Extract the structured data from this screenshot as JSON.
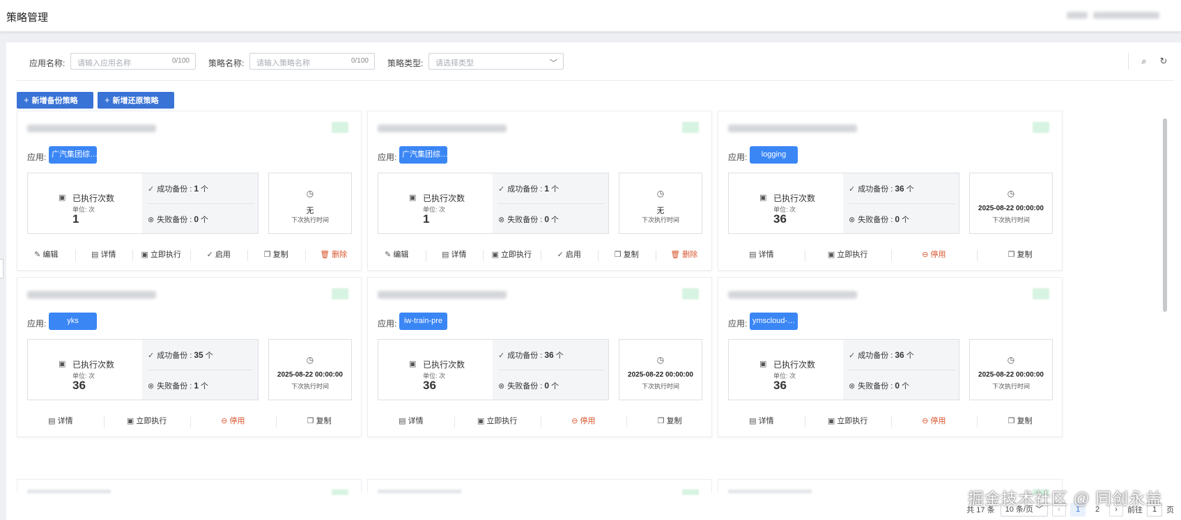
{
  "header": {
    "title": "策略管理"
  },
  "filters": {
    "app_name": {
      "label": "应用名称:",
      "placeholder": "请输入应用名称",
      "counter": "0/100"
    },
    "policy_name": {
      "label": "策略名称:",
      "placeholder": "请输入策略名称",
      "counter": "0/100"
    },
    "policy_type": {
      "label": "策略类型:",
      "placeholder": "请选择类型"
    }
  },
  "toolbar": {
    "add_backup_label": "新增备份策略",
    "add_restore_label": "新增还原策略",
    "plus_icon": "+"
  },
  "labels": {
    "app_prefix": "应用:",
    "exec_title": "已执行次数",
    "exec_unit": "单位: 次",
    "success_label": "成功备份 :",
    "fail_label": "失败备份 :",
    "count_unit": "个",
    "next_caption": "下次执行时间"
  },
  "cards": [
    {
      "app": "广汽集团综…",
      "exec_count": "1",
      "success": "1",
      "fail": "0",
      "next_time": "无",
      "actions": [
        {
          "label": "编辑",
          "icon": "edit-icon",
          "glyph": "✎"
        },
        {
          "label": "详情",
          "icon": "detail-icon",
          "glyph": "▤"
        },
        {
          "label": "立即执行",
          "icon": "execute-icon",
          "glyph": "▣"
        },
        {
          "label": "启用",
          "icon": "enable-icon",
          "glyph": "✓"
        },
        {
          "label": "复制",
          "icon": "copy-icon",
          "glyph": "❐"
        },
        {
          "label": "删除",
          "icon": "delete-icon",
          "glyph": "🗑"
        }
      ]
    },
    {
      "app": "广汽集团综…",
      "exec_count": "1",
      "success": "1",
      "fail": "0",
      "next_time": "无",
      "actions": [
        {
          "label": "编辑",
          "icon": "edit-icon",
          "glyph": "✎"
        },
        {
          "label": "详情",
          "icon": "detail-icon",
          "glyph": "▤"
        },
        {
          "label": "立即执行",
          "icon": "execute-icon",
          "glyph": "▣"
        },
        {
          "label": "启用",
          "icon": "enable-icon",
          "glyph": "✓"
        },
        {
          "label": "复制",
          "icon": "copy-icon",
          "glyph": "❐"
        },
        {
          "label": "删除",
          "icon": "delete-icon",
          "glyph": "🗑"
        }
      ]
    },
    {
      "app": "logging",
      "exec_count": "36",
      "success": "36",
      "fail": "0",
      "next_time": "2025-08-22 00:00:00",
      "actions": [
        {
          "label": "详情",
          "icon": "detail-icon",
          "glyph": "▤"
        },
        {
          "label": "立即执行",
          "icon": "execute-icon",
          "glyph": "▣"
        },
        {
          "label": "停用",
          "icon": "disable-icon",
          "glyph": "⊖"
        },
        {
          "label": "复制",
          "icon": "copy-icon",
          "glyph": "❐"
        }
      ]
    },
    {
      "app": "yks",
      "exec_count": "36",
      "success": "35",
      "fail": "1",
      "next_time": "2025-08-22 00:00:00",
      "actions": [
        {
          "label": "详情",
          "icon": "detail-icon",
          "glyph": "▤"
        },
        {
          "label": "立即执行",
          "icon": "execute-icon",
          "glyph": "▣"
        },
        {
          "label": "停用",
          "icon": "disable-icon",
          "glyph": "⊖"
        },
        {
          "label": "复制",
          "icon": "copy-icon",
          "glyph": "❐"
        }
      ]
    },
    {
      "app": "iw-train-pre",
      "exec_count": "36",
      "success": "36",
      "fail": "0",
      "next_time": "2025-08-22 00:00:00",
      "actions": [
        {
          "label": "详情",
          "icon": "detail-icon",
          "glyph": "▤"
        },
        {
          "label": "立即执行",
          "icon": "execute-icon",
          "glyph": "▣"
        },
        {
          "label": "停用",
          "icon": "disable-icon",
          "glyph": "⊖"
        },
        {
          "label": "复制",
          "icon": "copy-icon",
          "glyph": "❐"
        }
      ]
    },
    {
      "app": "ymscloud-…",
      "exec_count": "36",
      "success": "36",
      "fail": "0",
      "next_time": "2025-08-22 00:00:00",
      "actions": [
        {
          "label": "详情",
          "icon": "detail-icon",
          "glyph": "▤"
        },
        {
          "label": "立即执行",
          "icon": "execute-icon",
          "glyph": "▣"
        },
        {
          "label": "停用",
          "icon": "disable-icon",
          "glyph": "⊖"
        },
        {
          "label": "复制",
          "icon": "copy-icon",
          "glyph": "❐"
        }
      ]
    }
  ],
  "pagination": {
    "total": "共 17 条",
    "page_size": "10 条/页",
    "pages": [
      "1",
      "2"
    ],
    "current": "1",
    "goto_label": "前往",
    "goto_value": "1",
    "page_suffix": "页"
  },
  "watermark": "掘金技术社区 @ 同创永益",
  "colors": {
    "primary": "#3a73d6",
    "tag": "#3a86f5",
    "warn": "#d9552d"
  }
}
